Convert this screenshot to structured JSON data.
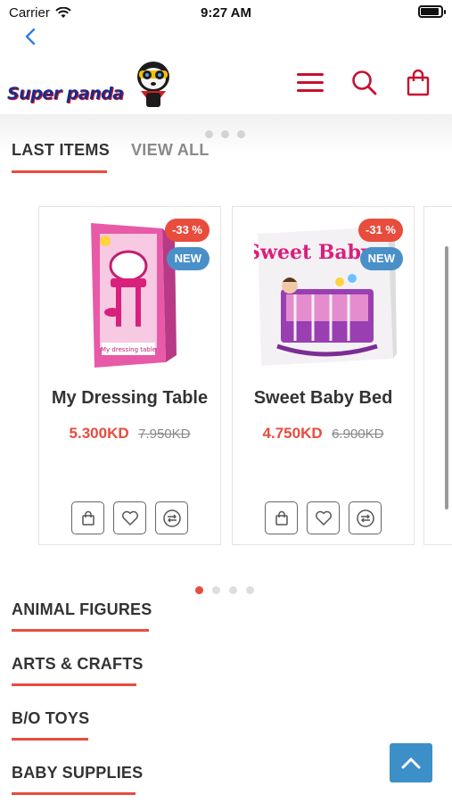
{
  "status_bar": {
    "carrier": "Carrier",
    "time": "9:27 AM"
  },
  "header": {
    "logo_text": "Super panda",
    "icons": [
      "back-chevron-icon",
      "hamburger-menu-icon",
      "search-icon",
      "shopping-bag-icon"
    ],
    "accent_color": "#c8102e"
  },
  "tabs": [
    {
      "label": "LAST ITEMS",
      "active": true
    },
    {
      "label": "VIEW ALL",
      "active": false
    }
  ],
  "products": [
    {
      "name": "My Dressing Table",
      "price": "5.300KD",
      "old_price": "7.950KD",
      "discount_badge": "-33 %",
      "new_badge": "NEW"
    },
    {
      "name": "Sweet Baby Bed",
      "price": "4.750KD",
      "old_price": "6.900KD",
      "discount_badge": "-31 %",
      "new_badge": "NEW",
      "image_text": "Sweet Baby"
    }
  ],
  "card_actions": [
    "add-to-cart-icon",
    "wishlist-heart-icon",
    "compare-icon"
  ],
  "slider": {
    "dot_count": 4,
    "active_index": 0
  },
  "categories": [
    {
      "label": "ANIMAL FIGURES"
    },
    {
      "label": "ARTS & CRAFTS"
    },
    {
      "label": "B/O TOYS"
    },
    {
      "label": "BABY SUPPLIES"
    }
  ],
  "colors": {
    "accent": "#e84c3d",
    "new_badge": "#4a90c8",
    "to_top_button": "#3d8fc8"
  }
}
